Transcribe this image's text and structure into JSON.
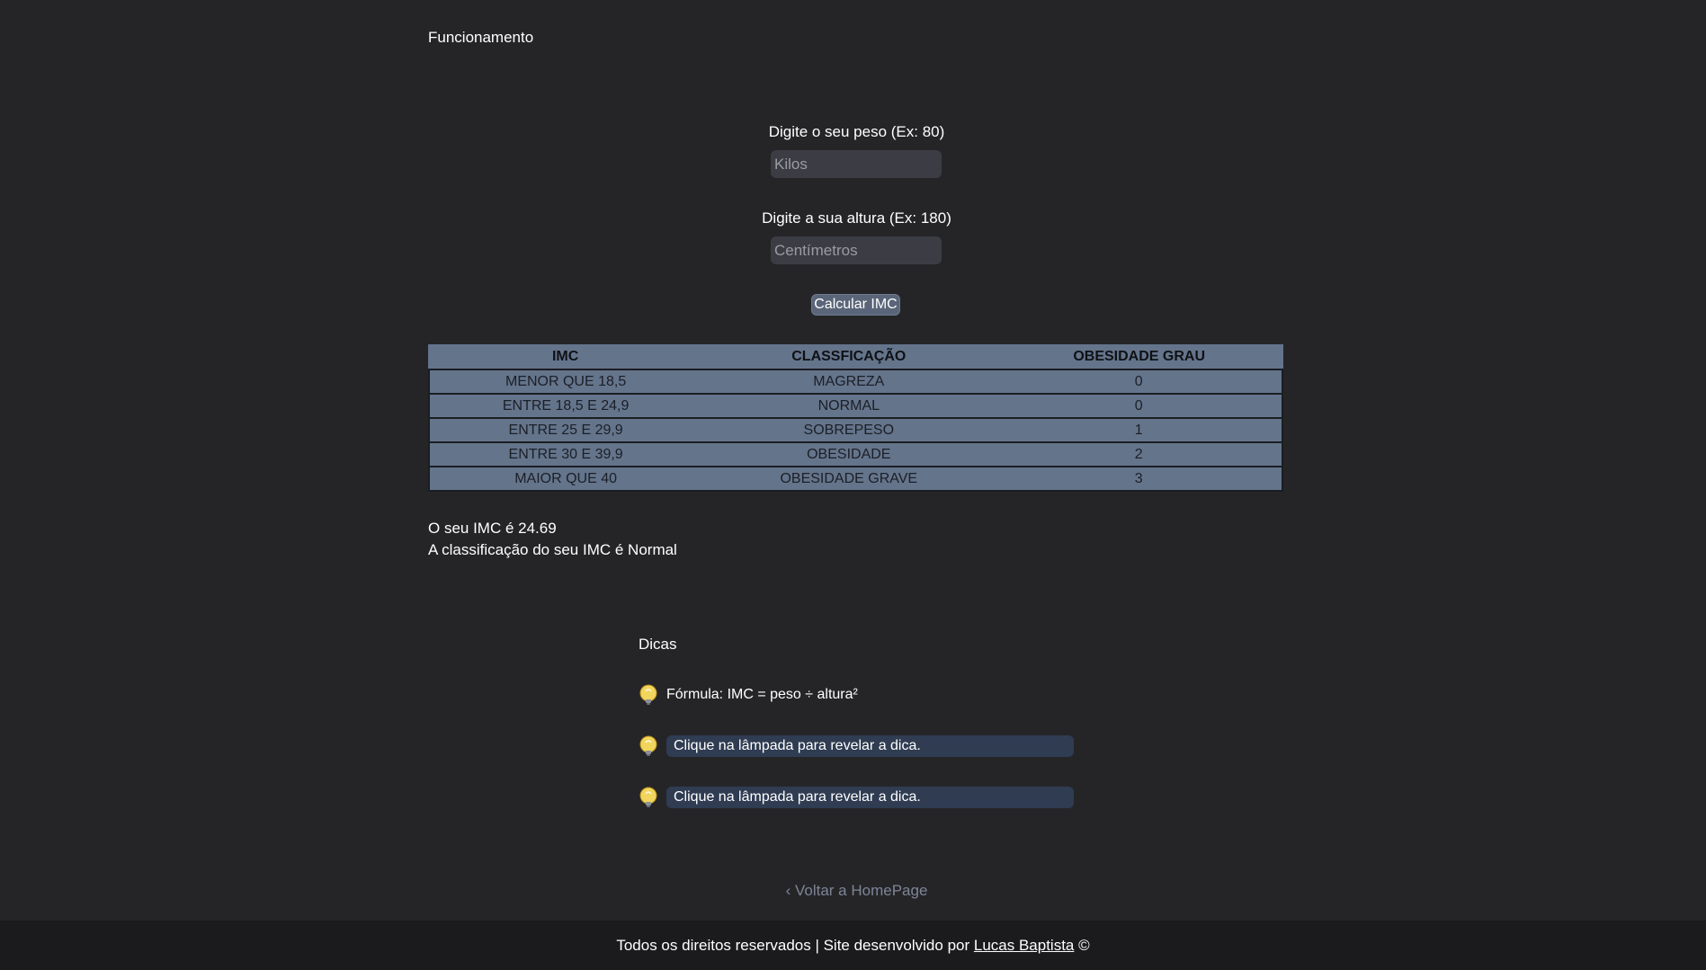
{
  "header": {
    "title": "Funcionamento"
  },
  "form": {
    "weight_label": "Digite o seu peso (Ex: 80)",
    "weight_placeholder": "Kilos",
    "weight_value": "",
    "height_label": "Digite a sua altura (Ex: 180)",
    "height_placeholder": "Centímetros",
    "height_value": "",
    "calculate_button": "Calcular IMC"
  },
  "table": {
    "headers": [
      "IMC",
      "CLASSFICAÇÃO",
      "OBESIDADE GRAU"
    ],
    "rows": [
      [
        "MENOR QUE 18,5",
        "MAGREZA",
        "0"
      ],
      [
        "ENTRE 18,5 E 24,9",
        "NORMAL",
        "0"
      ],
      [
        "ENTRE 25 E 29,9",
        "SOBREPESO",
        "1"
      ],
      [
        "ENTRE 30 E 39,9",
        "OBESIDADE",
        "2"
      ],
      [
        "MAIOR QUE 40",
        "OBESIDADE GRAVE",
        "3"
      ]
    ]
  },
  "result": {
    "imc_text": "O seu IMC é 24.69",
    "classification_text": "A classificação do seu IMC é Normal"
  },
  "tips": {
    "title": "Dicas",
    "revealed": "Fórmula: IMC = peso ÷ altura²",
    "hidden_1": "Clique na lâmpada para revelar a dica.",
    "hidden_2": "Clique na lâmpada para revelar a dica."
  },
  "navigation": {
    "back_link": "‹ Voltar a HomePage"
  },
  "footer": {
    "prefix": "Todos os direitos reservados | Site desenvolvido por",
    "author": "Lucas Baptista",
    "suffix": "©"
  },
  "colors": {
    "background": "#252528",
    "table_bg": "#64748b",
    "button_bg": "#5a6579",
    "tip_box_bg": "#2f3c52",
    "footer_bg": "#1b1b1d",
    "bulb": "#f2d55c"
  },
  "icons": {
    "bulb": "lightbulb-icon"
  }
}
